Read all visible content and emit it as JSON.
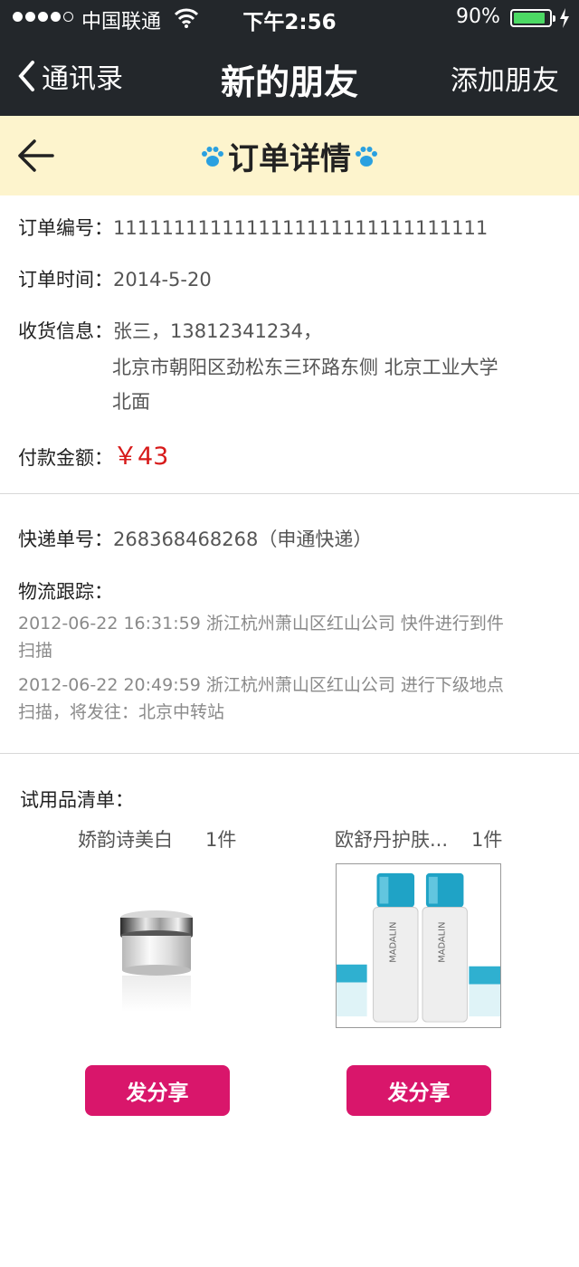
{
  "status_bar": {
    "carrier": "中国联通",
    "time": "下午2:56",
    "battery": "90%"
  },
  "nav": {
    "back_label": "通讯录",
    "title": "新的朋友",
    "right_label": "添加朋友"
  },
  "header": {
    "title": "订单详情"
  },
  "order": {
    "number_label": "订单编号：",
    "number_value": "1111111111111111111111111111111",
    "time_label": "订单时间：",
    "time_value": "2014-5-20",
    "shipping_label": "收货信息：",
    "shipping_line1": "张三，13812341234，",
    "shipping_line2": "北京市朝阳区劲松东三环路东侧  北京工业大学",
    "shipping_line3": "北面",
    "payment_label": "付款金额：",
    "payment_value": "￥43"
  },
  "delivery": {
    "tracking_label": "快递单号：",
    "tracking_value": "268368468268（申通快递）",
    "logistics_label": "物流跟踪：",
    "log1_line1": "2012-06-22 16:31:59 浙江杭州萧山区红山公司 快件进行到件",
    "log1_line2": "扫描",
    "log2_line1": "2012-06-22 20:49:59 浙江杭州萧山区红山公司 进行下级地点",
    "log2_line2": "扫描，将发往：北京中转站"
  },
  "samples": {
    "title": "试用品清单：",
    "items": [
      {
        "name": "娇韵诗美白",
        "qty": "1件",
        "button": "发分享"
      },
      {
        "name": "欧舒丹护肤...",
        "qty": "1件",
        "button": "发分享"
      }
    ]
  },
  "colors": {
    "topbar": "#23272b",
    "subheader": "#fdf4cd",
    "accent_button": "#d9166b",
    "price": "#d71a1a",
    "paw": "#2aa0e0"
  }
}
